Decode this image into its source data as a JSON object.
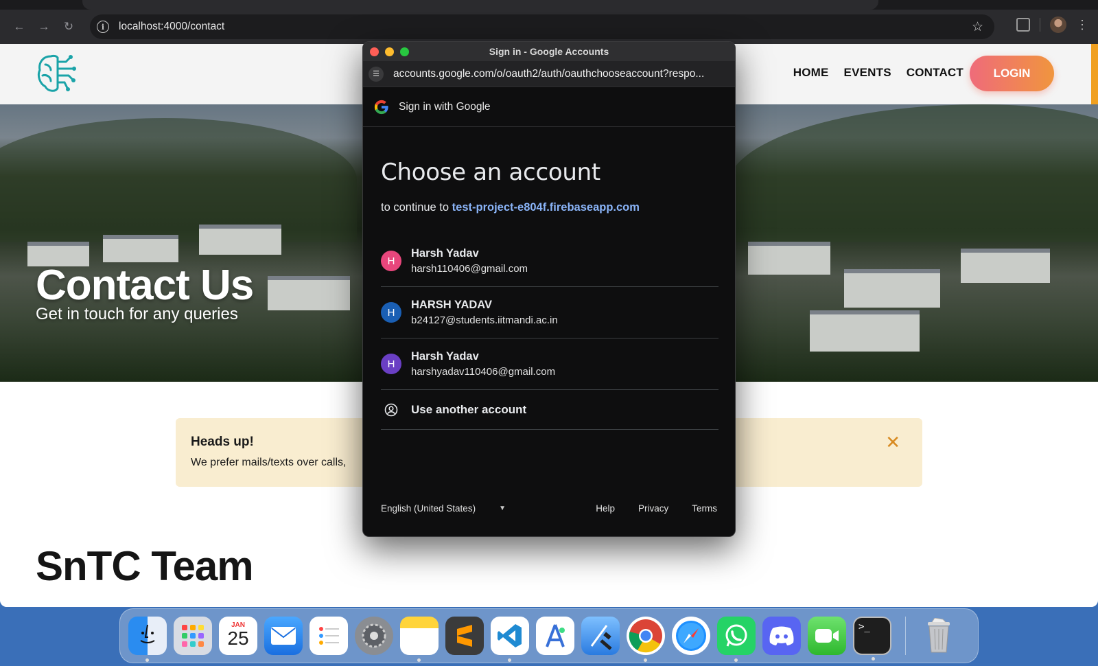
{
  "browser": {
    "url": "localhost:4000/contact"
  },
  "site": {
    "nav": [
      "HOME",
      "EVENTS",
      "CONTACT"
    ],
    "login_label": "LOGIN",
    "hero_title": "Contact Us",
    "hero_subtitle": "Get in touch for any queries",
    "alert": {
      "title": "Heads up!",
      "body": "We prefer mails/texts over calls,",
      "close": "✕"
    },
    "team_title": "SnTC Team"
  },
  "popup": {
    "window_title": "Sign in - Google Accounts",
    "url": "accounts.google.com/o/oauth2/auth/oauthchooseaccount?respo...",
    "signin_label": "Sign in with Google",
    "heading": "Choose an account",
    "continue_prefix": "to continue to",
    "continue_link": "test-project-e804f.firebaseapp.com",
    "accounts": [
      {
        "initial": "H",
        "name": "Harsh Yadav",
        "email": "harsh110406@gmail.com",
        "color": "#e8467c"
      },
      {
        "initial": "H",
        "name": "HARSH YADAV",
        "email": "b24127@students.iitmandi.ac.in",
        "color": "#1a5fb4"
      },
      {
        "initial": "H",
        "name": "Harsh Yadav",
        "email": "harshyadav110406@gmail.com",
        "color": "#6a3fc4"
      }
    ],
    "another_account": "Use another account",
    "language": "English (United States)",
    "footer_links": [
      "Help",
      "Privacy",
      "Terms"
    ]
  },
  "dock": {
    "calendar_month": "JAN",
    "calendar_day": "25",
    "apps": [
      "finder-icon",
      "launchpad-icon",
      "calendar-icon",
      "mail-icon",
      "reminders-icon",
      "system-settings-icon",
      "notes-icon",
      "sublime-text-icon",
      "vscode-icon",
      "android-studio-icon",
      "xcode-icon",
      "chrome-icon",
      "safari-icon",
      "whatsapp-icon",
      "discord-icon",
      "facetime-icon",
      "terminal-icon",
      "trash-icon"
    ]
  }
}
